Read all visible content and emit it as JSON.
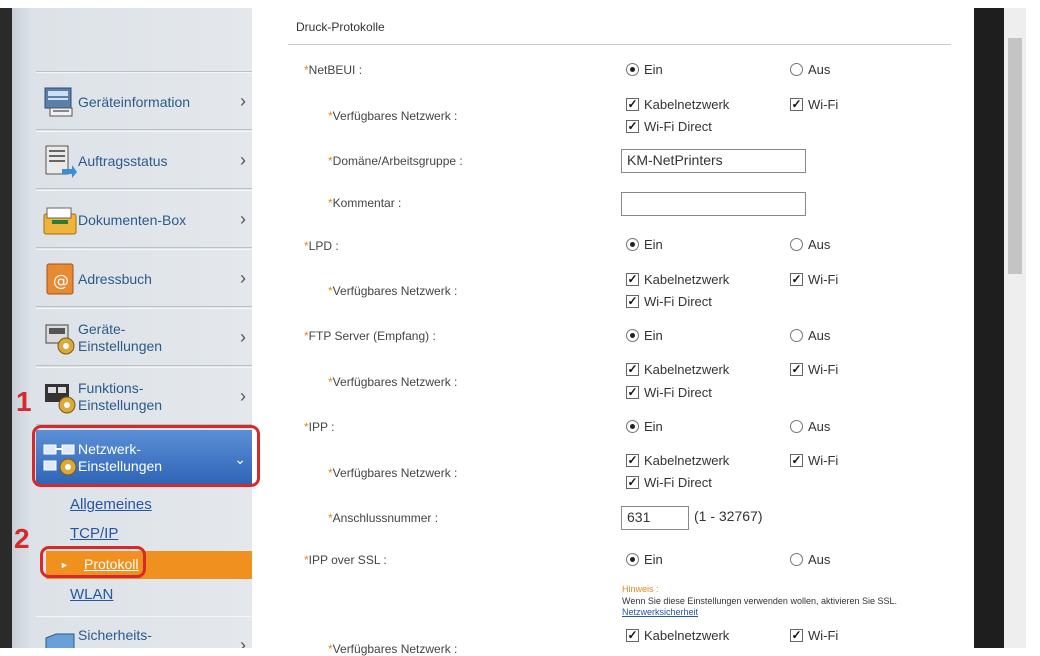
{
  "sidebar": {
    "items": [
      {
        "label": "Geräteinformation"
      },
      {
        "label": "Auftragsstatus"
      },
      {
        "label": "Dokumenten-Box"
      },
      {
        "label": "Adressbuch"
      },
      {
        "label": "Geräte-\nEinstellungen"
      },
      {
        "label": "Funktions-\nEinstellungen"
      },
      {
        "label": "Netzwerk-\nEinstellungen"
      },
      {
        "label": "Sicherheits-"
      }
    ],
    "sub_items": {
      "general": "Allgemeines",
      "tcpip": "TCP/IP",
      "protocol": "Protokoll",
      "wlan": "WLAN"
    },
    "markers": {
      "one": "1",
      "two": "2"
    }
  },
  "main": {
    "section_title": "Druck-Protokolle",
    "labels": {
      "netbeui": "NetBEUI :",
      "network": "Verfügbares Netzwerk :",
      "domain": "Domäne/Arbeitsgruppe :",
      "comment": "Kommentar :",
      "lpd": "LPD :",
      "ftp": "FTP Server (Empfang) :",
      "ipp": "IPP :",
      "port": "Anschlussnummer :",
      "ippssl": "IPP over SSL :"
    },
    "options": {
      "on": "Ein",
      "off": "Aus",
      "cable": "Kabelnetzwerk",
      "wifi": "Wi-Fi",
      "wifi_direct": "Wi-Fi Direct"
    },
    "fields": {
      "domain_value": "KM-NetPrinters",
      "comment_value": "",
      "port_value": "631",
      "port_range": "(1 - 32767)"
    },
    "hint": {
      "heading": "Hinweis :",
      "text": "Wenn Sie diese Einstellungen verwenden wollen, aktivieren Sie SSL.",
      "link": "Netzwerksicherheit"
    }
  },
  "colors": {
    "accent": "#f0901e",
    "active_nav": "#2d63b6",
    "callout": "#d8282a",
    "required_star": "#e08a1e"
  }
}
